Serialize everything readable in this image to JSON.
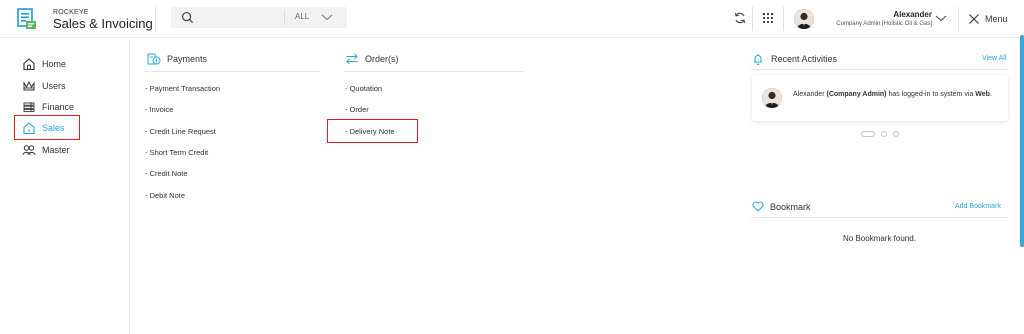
{
  "app": {
    "brand_small": "ROCKEYE",
    "brand_title": "Sales & Invoicing"
  },
  "search": {
    "filter_value": "ALL",
    "placeholder": ""
  },
  "user": {
    "name": "Alexander",
    "role": "Company Admin [Holistic Oil & Gas]"
  },
  "menu_label": "Menu",
  "sidebar": {
    "items": [
      {
        "label": "Home",
        "icon": "home-icon"
      },
      {
        "label": "Users",
        "icon": "crown-icon"
      },
      {
        "label": "Finance",
        "icon": "finance-icon"
      },
      {
        "label": "Sales",
        "icon": "sales-icon",
        "active": true
      },
      {
        "label": "Master",
        "icon": "group-icon"
      }
    ]
  },
  "payments": {
    "title": "Payments",
    "links": [
      "- Payment Transaction",
      "- Invoice",
      "- Credit Line Request",
      "- Short Term Credit",
      "- Credit Note",
      "- Debit Note"
    ]
  },
  "orders": {
    "title": "Order(s)",
    "links": [
      "- Quotation",
      "- Order",
      "- Delivery Note"
    ]
  },
  "recent_activities": {
    "title": "Recent Activities",
    "view_all": "View All",
    "activity": {
      "name": "Alexander",
      "role": "(Company Admin)",
      "middle": " has logged-in to system via ",
      "channel": "Web",
      "end": "."
    }
  },
  "bookmark": {
    "title": "Bookmark",
    "add_label": "Add Bookmark",
    "empty_text": "No Bookmark found."
  },
  "colors": {
    "accent": "#2aa7d9",
    "highlight": "#e02020"
  }
}
